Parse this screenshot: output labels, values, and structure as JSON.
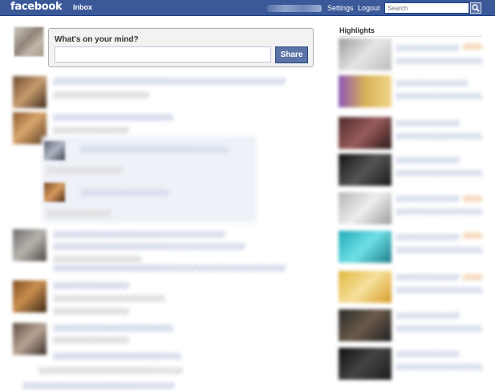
{
  "topbar": {
    "logo": "facebook",
    "nav_inbox": "Inbox",
    "nav_settings": "Settings",
    "nav_logout": "Logout",
    "search_placeholder": "Search",
    "search_icon": "magnifier-icon"
  },
  "composer": {
    "prompt": "What's on your mind?",
    "input_value": "",
    "share_label": "Share"
  },
  "sidebar": {
    "highlights_title": "Highlights"
  },
  "colors": {
    "brand_blue": "#3b5998",
    "button_blue": "#5b74a8",
    "composer_bg": "#f2f2f2"
  }
}
